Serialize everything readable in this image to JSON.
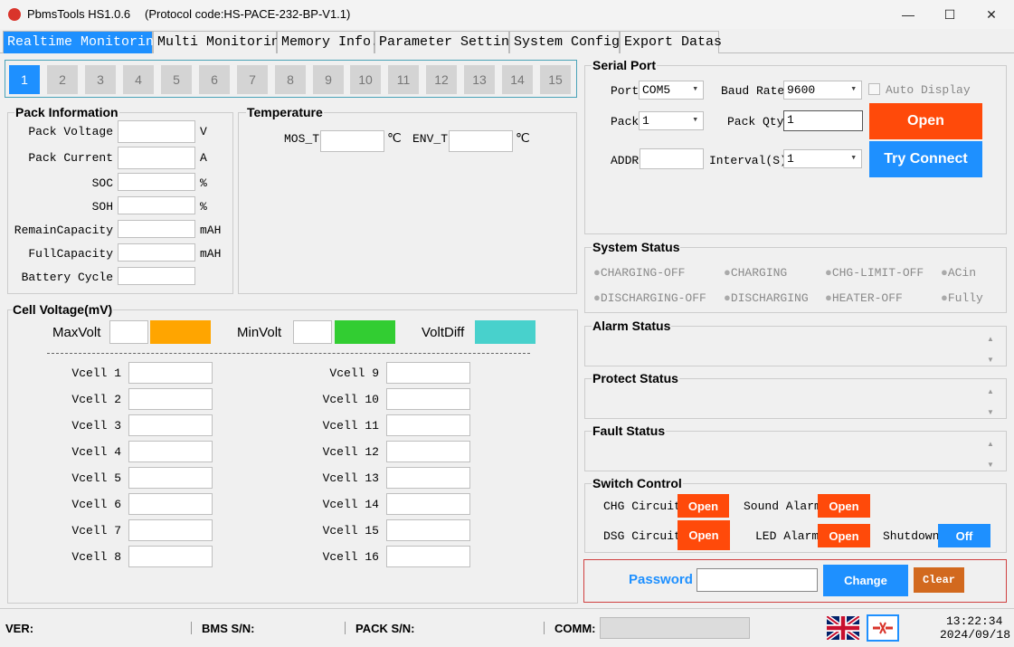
{
  "window": {
    "title": "PbmsTools HS1.0.6",
    "protocol": "(Protocol code:HS-PACE-232-BP-V1.1)",
    "minimize_glyph": "—",
    "maximize_glyph": "☐",
    "close_glyph": "✕"
  },
  "tabs": [
    {
      "label": "Realtime Monitoring"
    },
    {
      "label": "Multi Monitoring"
    },
    {
      "label": "Memory Info."
    },
    {
      "label": "Parameter Setting"
    },
    {
      "label": "System Config."
    },
    {
      "label": "Export Datas"
    }
  ],
  "pack_numbers": [
    "1",
    "2",
    "3",
    "4",
    "5",
    "6",
    "7",
    "8",
    "9",
    "10",
    "11",
    "12",
    "13",
    "14",
    "15"
  ],
  "pack_info": {
    "title": "Pack Information",
    "rows": [
      {
        "label": "Pack Voltage",
        "unit": "V"
      },
      {
        "label": "Pack Current",
        "unit": "A"
      },
      {
        "label": "SOC",
        "unit": "%"
      },
      {
        "label": "SOH",
        "unit": "%"
      },
      {
        "label": "RemainCapacity",
        "unit": "mAH"
      },
      {
        "label": "FullCapacity",
        "unit": "mAH"
      },
      {
        "label": "Battery Cycle",
        "unit": ""
      }
    ]
  },
  "temperature": {
    "title": "Temperature",
    "mos_label": "MOS_T",
    "env_label": "ENV_T",
    "unit": "℃"
  },
  "cell_voltage": {
    "title": "Cell Voltage(mV)",
    "max_label": "MaxVolt",
    "min_label": "MinVolt",
    "diff_label": "VoltDiff",
    "max_color": "#ffa500",
    "min_color": "#32cd32",
    "diff_color": "#48d1cc",
    "left": [
      "Vcell 1",
      "Vcell 2",
      "Vcell 3",
      "Vcell 4",
      "Vcell 5",
      "Vcell 6",
      "Vcell 7",
      "Vcell 8"
    ],
    "right": [
      "Vcell 9",
      "Vcell 10",
      "Vcell 11",
      "Vcell 12",
      "Vcell 13",
      "Vcell 14",
      "Vcell 15",
      "Vcell 16"
    ]
  },
  "serial": {
    "title": "Serial Port",
    "port_label": "Port",
    "port_value": "COM5",
    "baud_label": "Baud Rate",
    "baud_value": "9600",
    "auto_display": "Auto Display",
    "pack_label": "Pack",
    "pack_value": "1",
    "packqty_label": "Pack Qty",
    "packqty_value": "1",
    "addr_label": "ADDR",
    "interval_label": "Interval(S)",
    "interval_value": "1",
    "open_label": "Open",
    "try_label": "Try Connect"
  },
  "system_status": {
    "title": "System Status",
    "items": [
      "CHARGING-OFF",
      "CHARGING",
      "CHG-LIMIT-OFF",
      "ACin",
      "DISCHARGING-OFF",
      "DISCHARGING",
      "HEATER-OFF",
      "Fully"
    ]
  },
  "alarm": {
    "title": "Alarm Status"
  },
  "protect": {
    "title": "Protect Status"
  },
  "fault": {
    "title": "Fault Status"
  },
  "switch": {
    "title": "Switch Control",
    "chg_label": "CHG Circuit",
    "chg_btn": "Open",
    "sound_label": "Sound Alarm",
    "sound_btn": "Open",
    "dsg_label": "DSG Circuit",
    "dsg_btn": "Open",
    "led_label": "LED Alarm",
    "led_btn": "Open",
    "shutdown_label": "Shutdown",
    "shutdown_btn": "Off"
  },
  "password": {
    "label": "Password",
    "change": "Change",
    "clear": "Clear"
  },
  "status_bar": {
    "ver": "VER:",
    "bms": "BMS S/N:",
    "pack": "PACK S/N:",
    "comm": "COMM:",
    "time": "13:22:34",
    "date": "2024/09/18"
  },
  "colors": {
    "accent": "#1e90ff",
    "orange": "#ff4a0a",
    "clear": "#d2691e",
    "password_border": "#d04040"
  }
}
